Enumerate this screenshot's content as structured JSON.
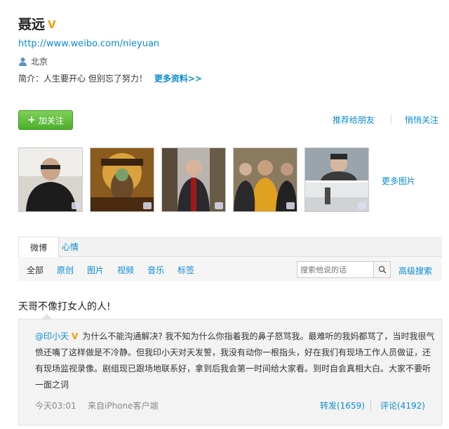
{
  "profile": {
    "name": "聂远",
    "verified_mark": "V",
    "url": "http://www.weibo.com/nieyuan",
    "location": "北京",
    "intro_label": "简介：",
    "intro_text": "人生要开心 但别忘了努力！",
    "more_info": "更多资料>>"
  },
  "actions": {
    "follow": "加关注",
    "recommend": "推荐给朋友",
    "quiet_follow": "悄悄关注"
  },
  "photos": {
    "more": "更多图片",
    "icons": [
      "photo-1",
      "photo-2",
      "photo-3",
      "photo-4",
      "photo-5"
    ]
  },
  "tabs": {
    "weibo": "微博",
    "mood": "心情"
  },
  "filters": {
    "all": "全部",
    "original": "原创",
    "pictures": "图片",
    "video": "视频",
    "music": "音乐",
    "tags": "标签"
  },
  "search": {
    "placeholder": "搜索他说的话",
    "advanced": "高级搜索"
  },
  "post": {
    "text": "天哥不像打女人的人!",
    "repost": {
      "author": "@印小天",
      "verified_mark": "V",
      "body": "为什么不能沟通解决? 我不知为什么你指着我的鼻子怒骂我。最难听的我妈都骂了，当时我很气愤还嘴了这样做是不冷静。但我印小天对天发誓，我没有动你一根指头，好在我们有现场工作人员做证，还有现场监视录像。剧组现已跟场地联系好，拿到后我会第一时间给大家看。到时自会真相大白。大家不要听一面之词",
      "time": "今天03:01",
      "source": "来自iPhone客户端",
      "forward": "转发(1659)",
      "comment": "评论(4192)"
    }
  },
  "colors": {
    "link": "#0a8cd2",
    "follow_green": "#4cae2a",
    "verified": "#f0a000"
  }
}
